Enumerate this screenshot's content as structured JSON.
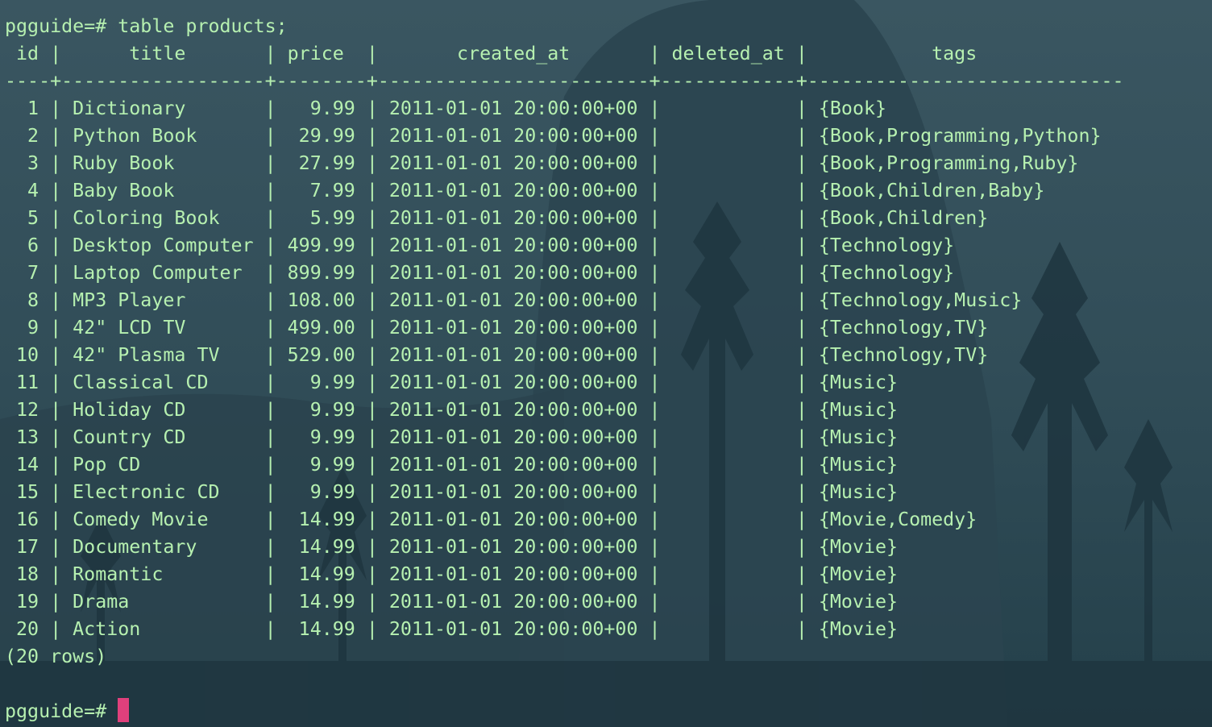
{
  "terminal": {
    "command_line": "pgguide=# table products;",
    "header_line": " id |      title       | price  |       created_at       | deleted_at |           tags",
    "separator_line": "----+------------------+--------+------------------------+------------+----------------------------",
    "rows": [
      "  1 | Dictionary       |   9.99 | 2011-01-01 20:00:00+00 |            | {Book}",
      "  2 | Python Book      |  29.99 | 2011-01-01 20:00:00+00 |            | {Book,Programming,Python}",
      "  3 | Ruby Book        |  27.99 | 2011-01-01 20:00:00+00 |            | {Book,Programming,Ruby}",
      "  4 | Baby Book        |   7.99 | 2011-01-01 20:00:00+00 |            | {Book,Children,Baby}",
      "  5 | Coloring Book    |   5.99 | 2011-01-01 20:00:00+00 |            | {Book,Children}",
      "  6 | Desktop Computer | 499.99 | 2011-01-01 20:00:00+00 |            | {Technology}",
      "  7 | Laptop Computer  | 899.99 | 2011-01-01 20:00:00+00 |            | {Technology}",
      "  8 | MP3 Player       | 108.00 | 2011-01-01 20:00:00+00 |            | {Technology,Music}",
      "  9 | 42\" LCD TV       | 499.00 | 2011-01-01 20:00:00+00 |            | {Technology,TV}",
      " 10 | 42\" Plasma TV    | 529.00 | 2011-01-01 20:00:00+00 |            | {Technology,TV}",
      " 11 | Classical CD     |   9.99 | 2011-01-01 20:00:00+00 |            | {Music}",
      " 12 | Holiday CD       |   9.99 | 2011-01-01 20:00:00+00 |            | {Music}",
      " 13 | Country CD       |   9.99 | 2011-01-01 20:00:00+00 |            | {Music}",
      " 14 | Pop CD           |   9.99 | 2011-01-01 20:00:00+00 |            | {Music}",
      " 15 | Electronic CD    |   9.99 | 2011-01-01 20:00:00+00 |            | {Music}",
      " 16 | Comedy Movie     |  14.99 | 2011-01-01 20:00:00+00 |            | {Movie,Comedy}",
      " 17 | Documentary      |  14.99 | 2011-01-01 20:00:00+00 |            | {Movie}",
      " 18 | Romantic         |  14.99 | 2011-01-01 20:00:00+00 |            | {Movie}",
      " 19 | Drama            |  14.99 | 2011-01-01 20:00:00+00 |            | {Movie}",
      " 20 | Action           |  14.99 | 2011-01-01 20:00:00+00 |            | {Movie}"
    ],
    "row_count_line": "(20 rows)",
    "prompt": "pgguide=#"
  },
  "colors": {
    "text": "#b6f0b0",
    "cursor": "#e0407c",
    "background": "#2f4a55"
  }
}
